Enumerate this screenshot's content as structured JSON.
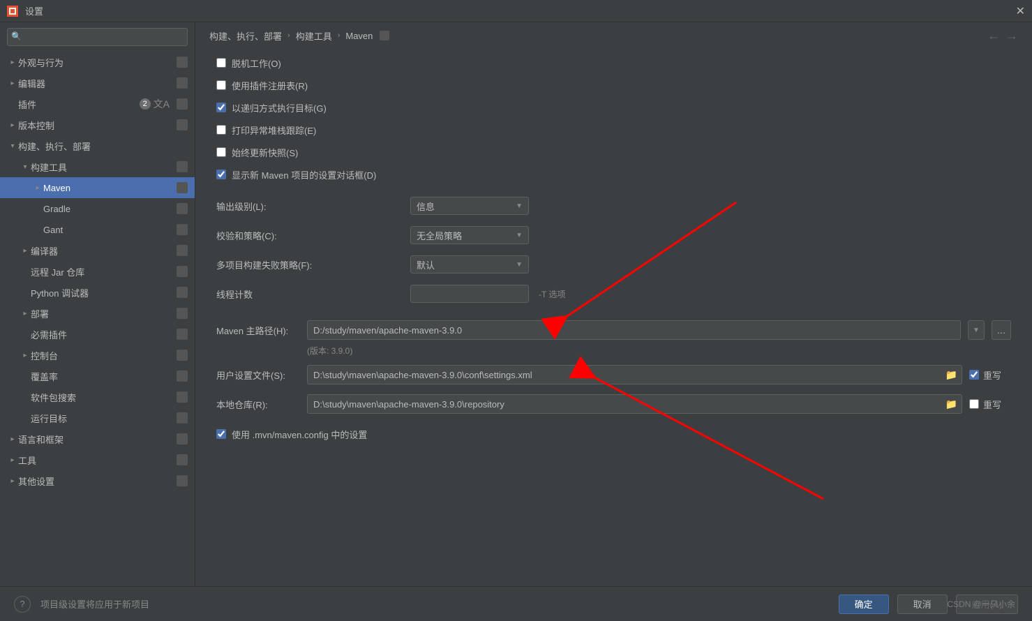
{
  "window": {
    "title": "设置"
  },
  "search": {
    "placeholder": ""
  },
  "sidebar": {
    "items": [
      {
        "label": "外观与行为",
        "depth": 0,
        "arrow": "right",
        "proj": true
      },
      {
        "label": "编辑器",
        "depth": 0,
        "arrow": "right",
        "proj": true
      },
      {
        "label": "插件",
        "depth": 0,
        "arrow": "none",
        "proj": true,
        "badge": "2",
        "lang": true
      },
      {
        "label": "版本控制",
        "depth": 0,
        "arrow": "right",
        "proj": true
      },
      {
        "label": "构建、执行、部署",
        "depth": 0,
        "arrow": "down",
        "proj": false
      },
      {
        "label": "构建工具",
        "depth": 1,
        "arrow": "down",
        "proj": true
      },
      {
        "label": "Maven",
        "depth": 2,
        "arrow": "right",
        "proj": true,
        "selected": true
      },
      {
        "label": "Gradle",
        "depth": 2,
        "arrow": "none",
        "proj": true
      },
      {
        "label": "Gant",
        "depth": 2,
        "arrow": "none",
        "proj": true
      },
      {
        "label": "编译器",
        "depth": 1,
        "arrow": "right",
        "proj": true
      },
      {
        "label": "远程 Jar 仓库",
        "depth": 1,
        "arrow": "none",
        "proj": true
      },
      {
        "label": "Python 调试器",
        "depth": 1,
        "arrow": "none",
        "proj": true
      },
      {
        "label": "部署",
        "depth": 1,
        "arrow": "right",
        "proj": true
      },
      {
        "label": "必需插件",
        "depth": 1,
        "arrow": "none",
        "proj": true
      },
      {
        "label": "控制台",
        "depth": 1,
        "arrow": "right",
        "proj": true
      },
      {
        "label": "覆盖率",
        "depth": 1,
        "arrow": "none",
        "proj": true
      },
      {
        "label": "软件包搜索",
        "depth": 1,
        "arrow": "none",
        "proj": true
      },
      {
        "label": "运行目标",
        "depth": 1,
        "arrow": "none",
        "proj": true
      },
      {
        "label": "语言和框架",
        "depth": 0,
        "arrow": "right",
        "proj": true
      },
      {
        "label": "工具",
        "depth": 0,
        "arrow": "right",
        "proj": true
      },
      {
        "label": "其他设置",
        "depth": 0,
        "arrow": "right",
        "proj": true
      }
    ]
  },
  "breadcrumb": {
    "a": "构建、执行、部署",
    "b": "构建工具",
    "c": "Maven"
  },
  "checks": {
    "offline": {
      "label": "脱机工作(O)",
      "checked": false
    },
    "plugins": {
      "label": "使用插件注册表(R)",
      "checked": false
    },
    "recursive": {
      "label": "以递归方式执行目标(G)",
      "checked": true
    },
    "stack": {
      "label": "打印异常堆栈跟踪(E)",
      "checked": false
    },
    "snapshot": {
      "label": "始终更新快照(S)",
      "checked": false
    },
    "dialog": {
      "label": "显示新 Maven 项目的设置对话框(D)",
      "checked": true
    },
    "useconfig": {
      "label": "使用 .mvn/maven.config 中的设置",
      "checked": true
    }
  },
  "fields": {
    "outputLevel": {
      "label": "输出级别(L):",
      "value": "信息"
    },
    "checksum": {
      "label": "校验和策略(C):",
      "value": "无全局策略"
    },
    "multiFail": {
      "label": "多项目构建失败策略(F):",
      "value": "默认"
    },
    "threads": {
      "label": "线程计数",
      "value": "",
      "hint": "-T 选项"
    }
  },
  "paths": {
    "home": {
      "label": "Maven 主路径(H):",
      "value": "D:/study/maven/apache-maven-3.9.0",
      "version": "(版本: 3.9.0)"
    },
    "user": {
      "label": "用户设置文件(S):",
      "value": "D:\\study\\maven\\apache-maven-3.9.0\\conf\\settings.xml",
      "override": "重写",
      "ochecked": true
    },
    "repo": {
      "label": "本地仓库(R):",
      "value": "D:\\study\\maven\\apache-maven-3.9.0\\repository",
      "override": "重写",
      "ochecked": false
    }
  },
  "footer": {
    "projectText": "项目级设置将应用于新项目",
    "ok": "确定",
    "cancel": "取消",
    "apply": "应用(A)",
    "watermark": "CSDN @一只小余"
  }
}
